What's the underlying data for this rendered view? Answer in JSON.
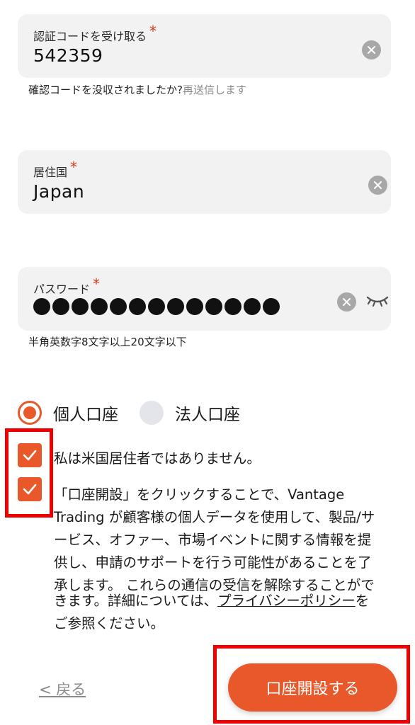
{
  "verification": {
    "label": "認証コードを受け取る",
    "required_mark": "*",
    "value": "542359",
    "helper_text": "確認コードを没収されましたか?",
    "resend_link": "再送信します"
  },
  "country": {
    "label": "居住国",
    "required_mark": "*",
    "value": "Japan"
  },
  "password": {
    "label": "パスワード",
    "required_mark": "*",
    "masked_count": 13,
    "helper_text": "半角英数字8文字以上20文字以下"
  },
  "account_type": {
    "options": [
      {
        "label": "個人口座",
        "selected": true
      },
      {
        "label": "法人口座",
        "selected": false
      }
    ]
  },
  "consents": {
    "not_us_resident": {
      "checked": true,
      "text": "私は米国居住者ではありません。"
    },
    "privacy": {
      "checked": true,
      "lines": [
        "「口座開設」をクリックすることで、Vantage",
        "Trading が顧客様の個人データを使用して、製品/サ",
        "ービス、オファー、市場イベントに関する情報を提",
        "供し、申請のサポートを行う可能性があることを了",
        "承します。 これらの通信の受信を解除することがで",
        "きます。詳細については、"
      ],
      "policy_link": "プライバシーポリシー",
      "after_link": "を",
      "last_line": "ご参照ください。"
    }
  },
  "footer": {
    "back_label": "< 戻る",
    "submit_label": "口座開設する"
  },
  "colors": {
    "accent": "#e8582a",
    "highlight_box": "#ee0000",
    "field_bg": "#f2f2f3"
  }
}
